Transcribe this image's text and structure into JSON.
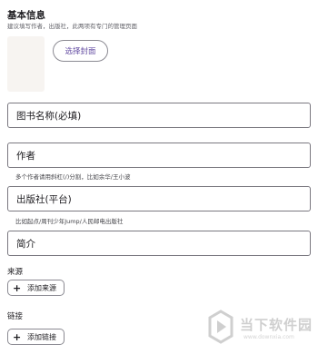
{
  "basic_info": {
    "title": "基本信息",
    "subtitle": "建议填写作者，出版社，此两项有专门的管理页面",
    "cover_button": "选择封面"
  },
  "fields": {
    "book_name": {
      "placeholder": "图书名称(必填)"
    },
    "author": {
      "placeholder": "作者",
      "hint": "多个作者请用斜杠(/)分割，比如余华/王小波"
    },
    "publisher": {
      "placeholder": "出版社(平台)",
      "hint": "比如起点/周刊少年Jump/人民邮电出版社"
    },
    "summary": {
      "placeholder": "简介"
    }
  },
  "source": {
    "label": "来源",
    "add_button": "添加来源",
    "add_icon": "+"
  },
  "link": {
    "label": "链接",
    "add_button": "添加链接",
    "add_icon": "+"
  },
  "watermark": {
    "text": "当下软件园",
    "url": "www.downxia.com"
  }
}
